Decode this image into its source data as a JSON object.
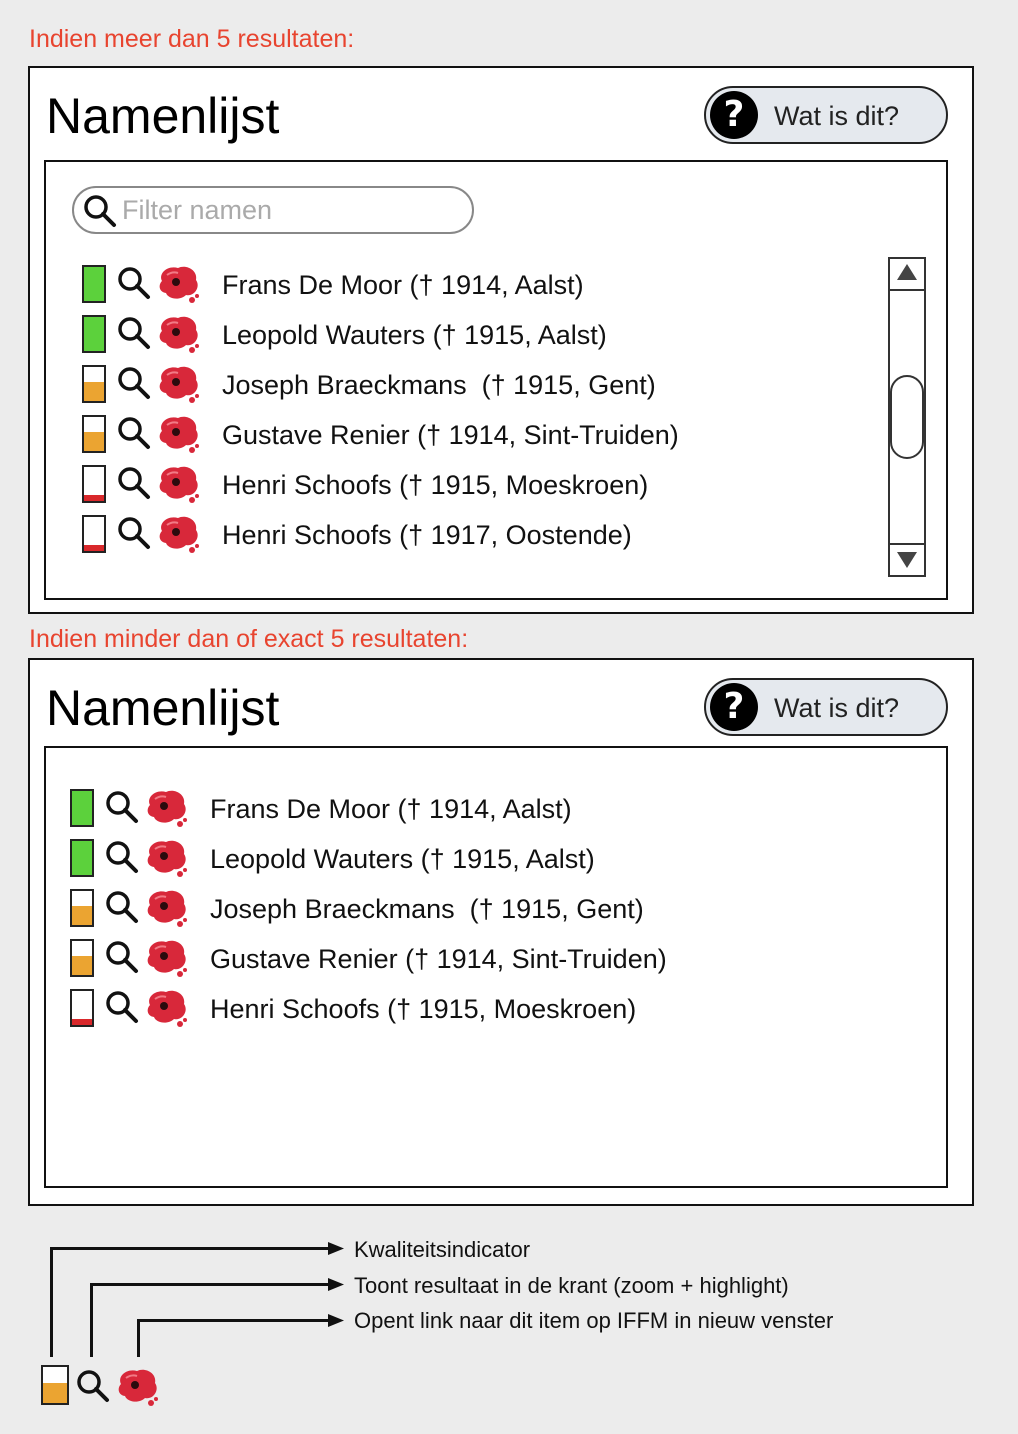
{
  "captions": {
    "more_than_5": "Indien meer dan 5 resultaten:",
    "max_5": "Indien minder dan of exact 5 resultaten:"
  },
  "panel_a": {
    "title": "Namenlijst",
    "help_label": "Wat is dit?",
    "help_icon": "?",
    "filter_placeholder": "Filter namen",
    "rows": [
      {
        "name": "Frans De Moor († 1914, Aalst)",
        "quality": "high",
        "fill": 1.0
      },
      {
        "name": "Leopold Wauters († 1915, Aalst)",
        "quality": "high",
        "fill": 1.0
      },
      {
        "name": "Joseph Braeckmans  († 1915, Gent)",
        "quality": "medium",
        "fill": 0.55
      },
      {
        "name": "Gustave Renier († 1914, Sint-Truiden)",
        "quality": "medium",
        "fill": 0.55
      },
      {
        "name": "Henri Schoofs († 1915, Moeskroen)",
        "quality": "low",
        "fill": 0.18
      },
      {
        "name": "Henri Schoofs († 1917, Oostende)",
        "quality": "low",
        "fill": 0.18
      }
    ]
  },
  "panel_b": {
    "title": "Namenlijst",
    "help_label": "Wat is dit?",
    "help_icon": "?",
    "rows": [
      {
        "name": "Frans De Moor († 1914, Aalst)",
        "quality": "high",
        "fill": 1.0
      },
      {
        "name": "Leopold Wauters († 1915, Aalst)",
        "quality": "high",
        "fill": 1.0
      },
      {
        "name": "Joseph Braeckmans  († 1915, Gent)",
        "quality": "medium",
        "fill": 0.55
      },
      {
        "name": "Gustave Renier († 1914, Sint-Truiden)",
        "quality": "medium",
        "fill": 0.55
      },
      {
        "name": "Henri Schoofs († 1915, Moeskroen)",
        "quality": "low",
        "fill": 0.18
      }
    ]
  },
  "legend": {
    "quality_indicator": "Kwaliteitsindicator",
    "show_result": "Toont resultaat in de krant (zoom + highlight)",
    "open_link": "Opent link naar dit item op IFFM in nieuw venster"
  },
  "colors": {
    "caption": "#e8442f",
    "quality_high": "#5cd13c",
    "quality_medium": "#eba431",
    "quality_low": "#d9282b",
    "poppy": "#d8283a"
  },
  "icons": {
    "search": "search-icon",
    "poppy": "poppy-icon",
    "help": "question-icon",
    "quality": "quality-indicator-icon"
  }
}
